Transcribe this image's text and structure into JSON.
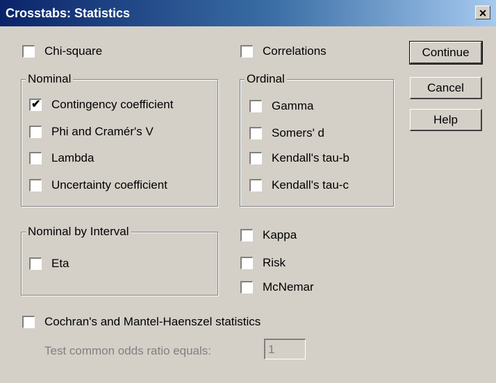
{
  "window": {
    "title": "Crosstabs: Statistics",
    "close_label": "×"
  },
  "checkboxes": {
    "chi_square": {
      "label": "Chi-square",
      "checked": false
    },
    "correlations": {
      "label": "Correlations",
      "checked": false
    },
    "contingency": {
      "label": "Contingency coefficient",
      "checked": true
    },
    "phi": {
      "label": "Phi and Cramér's V",
      "checked": false
    },
    "lambda": {
      "label": "Lambda",
      "checked": false
    },
    "uncertainty": {
      "label": "Uncertainty coefficient",
      "checked": false
    },
    "gamma": {
      "label": "Gamma",
      "checked": false
    },
    "somers": {
      "label": "Somers' d",
      "checked": false
    },
    "tau_b": {
      "label": "Kendall's tau-b",
      "checked": false
    },
    "tau_c": {
      "label": "Kendall's tau-c",
      "checked": false
    },
    "eta": {
      "label": "Eta",
      "checked": false
    },
    "kappa": {
      "label": "Kappa",
      "checked": false
    },
    "risk": {
      "label": "Risk",
      "checked": false
    },
    "mcnemar": {
      "label": "McNemar",
      "checked": false
    },
    "cochran": {
      "label": "Cochran's and Mantel-Haenszel statistics",
      "checked": false
    }
  },
  "groups": {
    "nominal": "Nominal",
    "ordinal": "Ordinal",
    "nominal_by_interval": "Nominal by Interval"
  },
  "buttons": {
    "continue": "Continue",
    "cancel": "Cancel",
    "help": "Help"
  },
  "odds": {
    "label": "Test common odds ratio equals:",
    "value": "1"
  },
  "check_glyph": "✔"
}
